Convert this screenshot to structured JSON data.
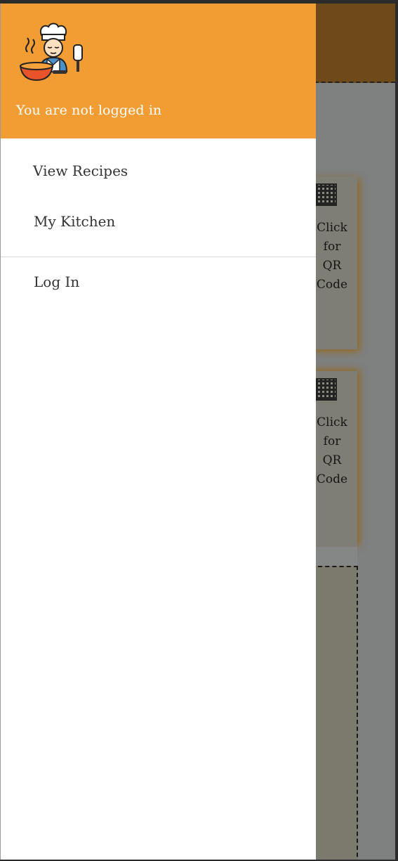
{
  "drawer": {
    "status_text": "You are not logged in",
    "avatar_icon": "chef-cooking-icon",
    "menu": {
      "view_recipes": "View Recipes",
      "my_kitchen": "My Kitchen",
      "log_in": "Log In"
    }
  },
  "background_page": {
    "cards": [
      {
        "qr_label": "Click\nfor\nQR\nCode",
        "icon": "qr-code-icon"
      },
      {
        "qr_label": "Click\nfor\nQR\nCode",
        "icon": "qr-code-icon"
      }
    ]
  },
  "colors": {
    "drawer_header": "#f29d33",
    "drawer_background": "#ffffff",
    "overlay_header": "#6e4a1a",
    "overlay_content": "#7e8180",
    "menu_text": "#333333"
  }
}
